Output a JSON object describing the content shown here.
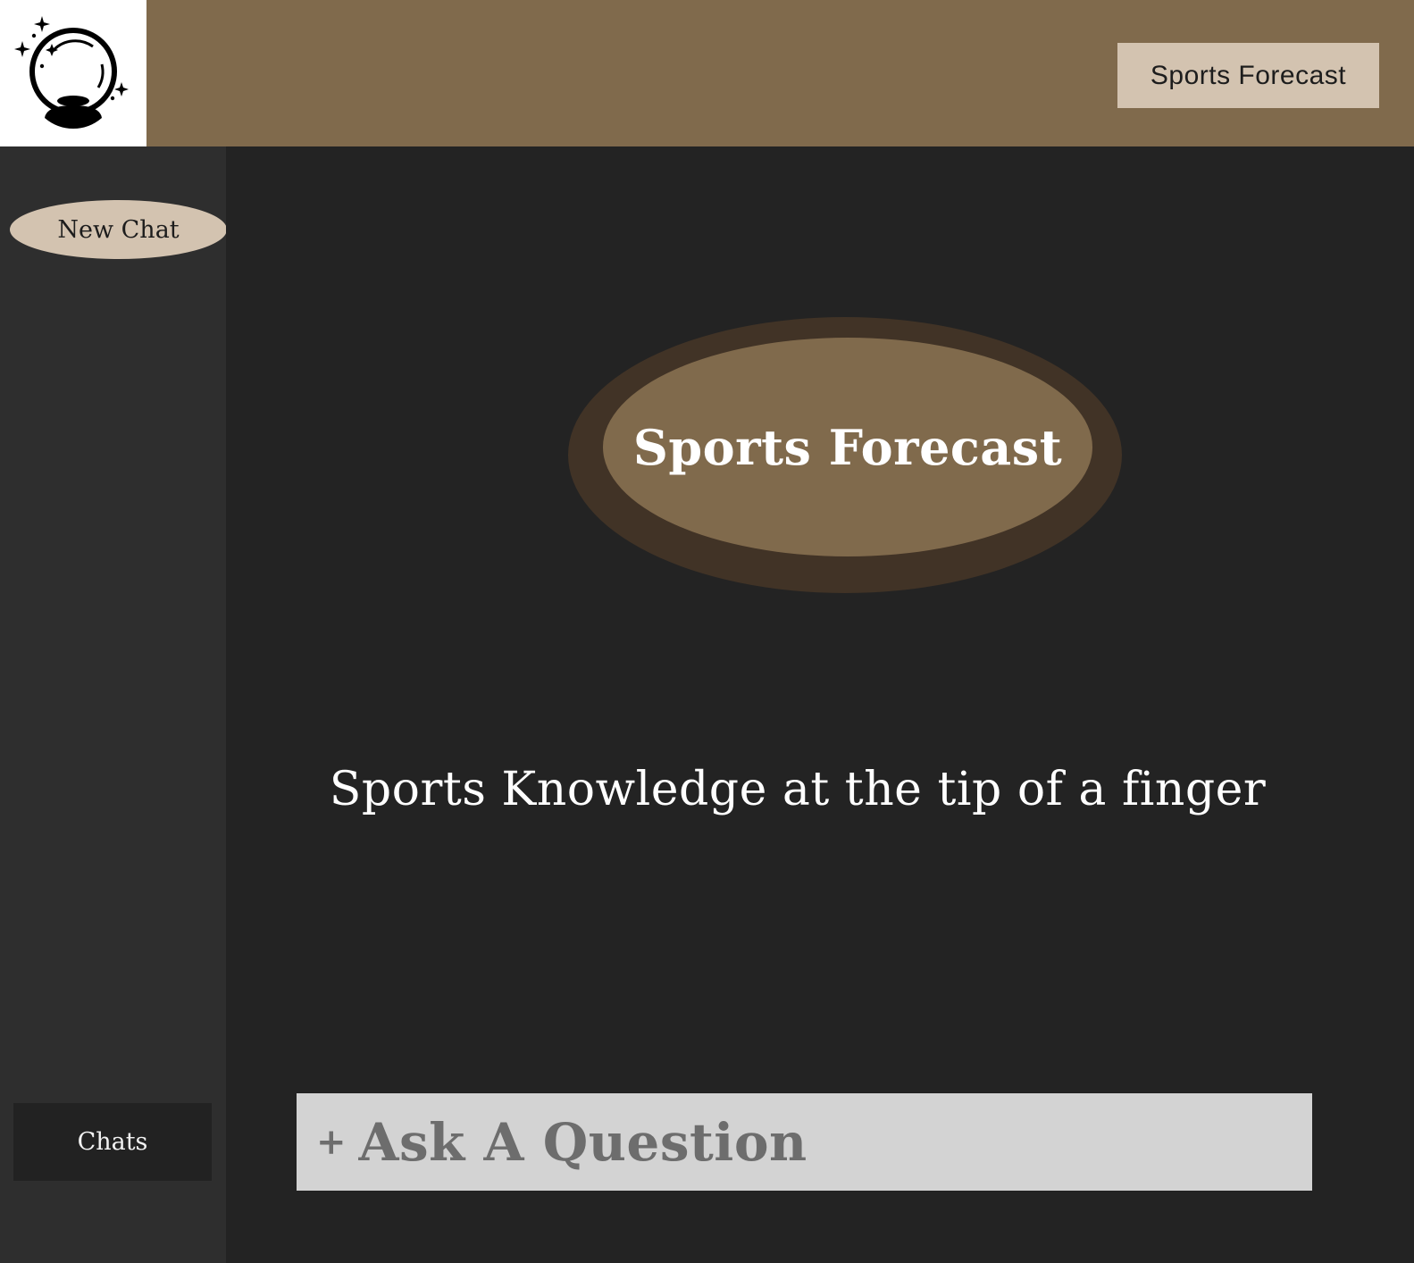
{
  "header": {
    "logo_icon": "crystal-ball-icon",
    "title_button_label": "Sports Forecast"
  },
  "sidebar": {
    "new_chat_label": "New Chat",
    "chats_label": "Chats"
  },
  "main": {
    "hero_title": "Sports Forecast",
    "tagline": "Sports Knowledge at the tip of a finger",
    "ask": {
      "plus": "+",
      "placeholder": "Ask A Question"
    }
  },
  "colors": {
    "header_brown": "#806a4c",
    "hero_ring": "#413326",
    "button_beige": "#d3c3b0",
    "background": "#232323",
    "sidebar": "#2e2e2e",
    "ask_bar": "#d3d3d3"
  }
}
